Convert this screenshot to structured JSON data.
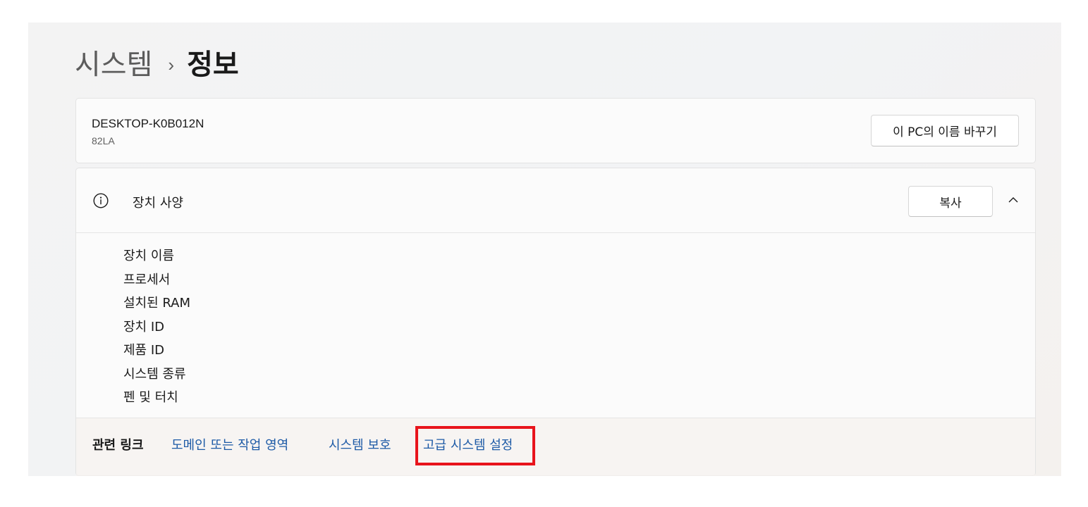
{
  "breadcrumb": {
    "parent": "시스템",
    "separator": "›",
    "current": "정보"
  },
  "device": {
    "name": "DESKTOP-K0B012N",
    "model": "82LA",
    "rename_button": "이 PC의 이름 바꾸기"
  },
  "specs": {
    "icon": "info-icon",
    "title": "장치 사양",
    "copy_button": "복사",
    "collapse_icon": "chevron-up-icon",
    "items": [
      "장치 이름",
      "프로세서",
      "설치된 RAM",
      "장치 ID",
      "제품 ID",
      "시스템 종류",
      "펜 및 터치"
    ]
  },
  "related": {
    "label": "관련 링크",
    "links": [
      "도메인 또는 작업 영역",
      "시스템 보호",
      "고급 시스템 설정"
    ]
  },
  "colors": {
    "link": "#1d5aa6",
    "highlight": "#e8141c"
  }
}
